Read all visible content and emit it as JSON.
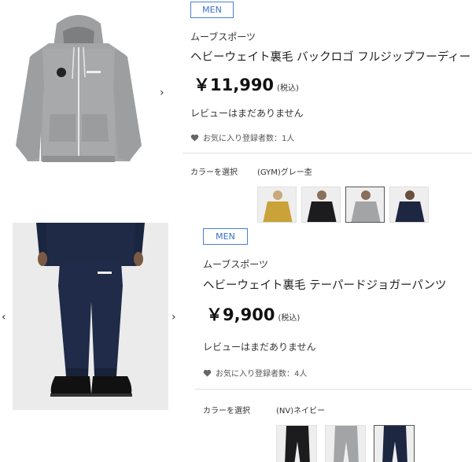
{
  "products": [
    {
      "badge": "MEN",
      "brand": "ムーブスポーツ",
      "name": "ヘビーウェイト裏毛 バックロゴ フルジップフーディー",
      "price": "￥11,990",
      "tax": "(税込)",
      "review": "レビューはまだありません",
      "favorites": "お気に入り登録者数：1人",
      "color_label": "カラーを選択",
      "selected_color": "(GYM)グレー杢",
      "image": "gray-hoodie-image",
      "swatches": [
        {
          "name": "mustard-hoodie-swatch",
          "color": "#c9a23a",
          "selected": false
        },
        {
          "name": "black-hoodie-swatch",
          "color": "#1c1c1e",
          "selected": false
        },
        {
          "name": "gray-hoodie-swatch",
          "color": "#a3a4a6",
          "selected": true
        },
        {
          "name": "navy-hoodie-swatch",
          "color": "#1d2742",
          "selected": false
        }
      ]
    },
    {
      "badge": "MEN",
      "brand": "ムーブスポーツ",
      "name": "ヘビーウェイト裏毛 テーパードジョガーパンツ",
      "price": "￥9,900",
      "tax": "(税込)",
      "review": "レビューはまだありません",
      "favorites": "お気に入り登録者数：4人",
      "color_label": "カラーを選択",
      "selected_color": "(NV)ネイビー",
      "image": "navy-jogger-pants-image",
      "swatches": [
        {
          "name": "black-pants-swatch",
          "color": "#1c1c1e",
          "selected": false
        },
        {
          "name": "gray-pants-swatch",
          "color": "#a3a4a6",
          "selected": false
        },
        {
          "name": "navy-pants-swatch",
          "color": "#1d2742",
          "selected": true
        }
      ]
    }
  ],
  "icons": {
    "next": "›",
    "prev": "‹",
    "heart": "heart-icon"
  }
}
